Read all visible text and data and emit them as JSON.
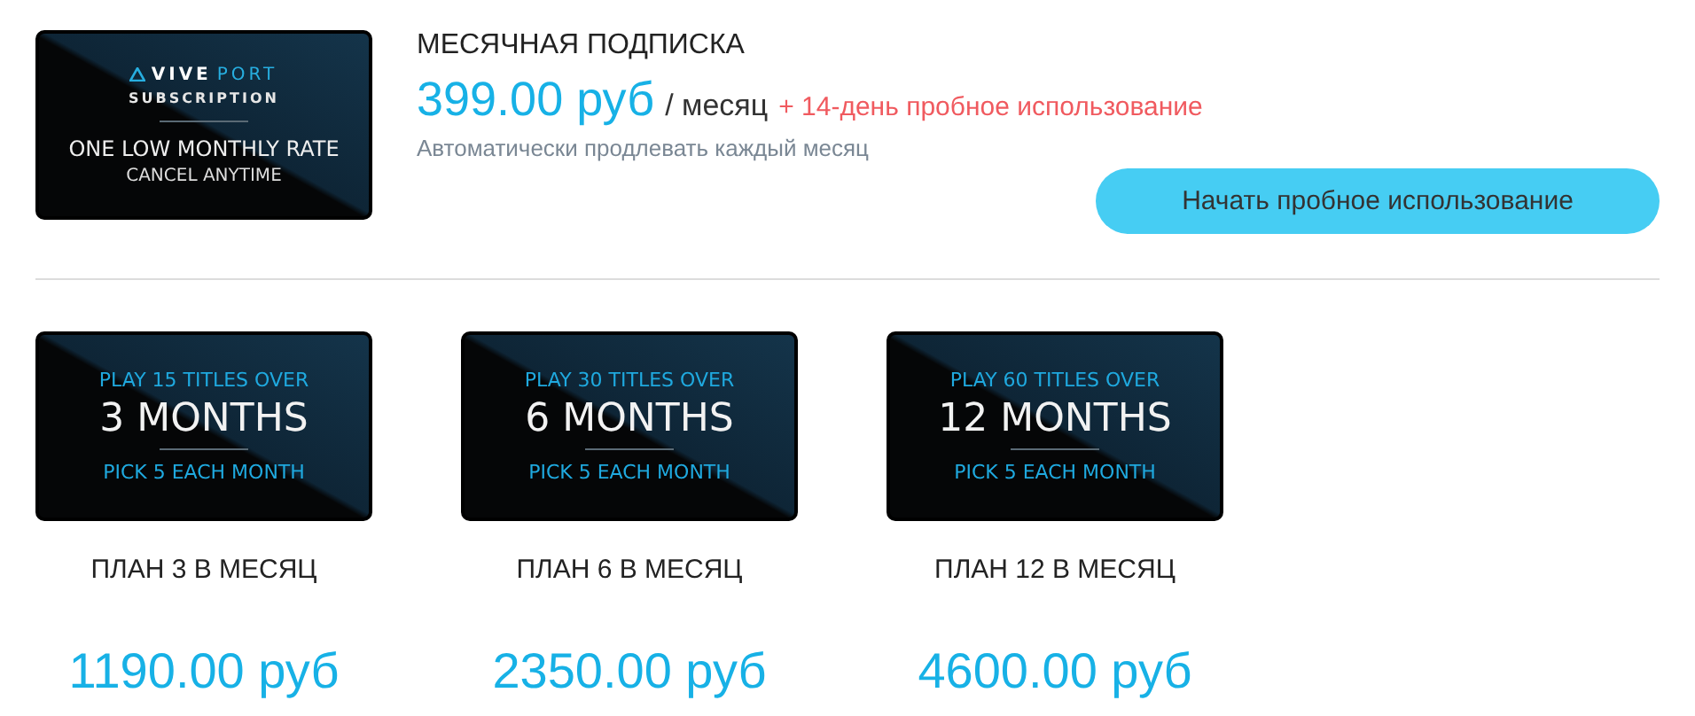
{
  "subscription": {
    "banner": {
      "brand_left": "VIVE",
      "brand_right": "PORT",
      "subtitle": "SUBSCRIPTION",
      "headline": "ONE LOW MONTHLY RATE",
      "tagline": "CANCEL ANYTIME"
    },
    "title": "МЕСЯЧНАЯ ПОДПИСКА",
    "price": "399.00 руб",
    "period": "/ месяц",
    "trial": "+ 14-день пробное использование",
    "note": "Автоматически продлевать каждый месяц",
    "button": "Начать пробное использование"
  },
  "plans": [
    {
      "banner": {
        "top": "PLAY 15 TITLES OVER",
        "main": "3 MONTHS",
        "bottom": "PICK 5 EACH MONTH"
      },
      "name": "ПЛАН 3 В МЕСЯЦ",
      "price": "1190.00 руб"
    },
    {
      "banner": {
        "top": "PLAY 30 TITLES OVER",
        "main": "6 MONTHS",
        "bottom": "PICK 5 EACH MONTH"
      },
      "name": "ПЛАН 6 В МЕСЯЦ",
      "price": "2350.00 руб"
    },
    {
      "banner": {
        "top": "PLAY 60 TITLES OVER",
        "main": "12 MONTHS",
        "bottom": "PICK 5 EACH MONTH"
      },
      "name": "ПЛАН 12 В МЕСЯЦ",
      "price": "4600.00 руб"
    }
  ]
}
